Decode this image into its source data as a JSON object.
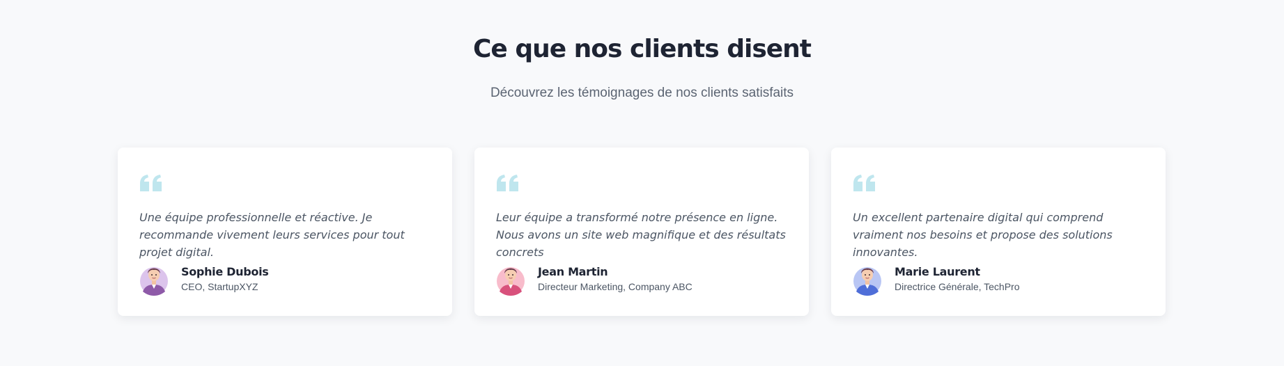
{
  "header": {
    "title": "Ce que nos clients disent",
    "subtitle": "Découvrez les témoignages de nos clients satisfaits"
  },
  "colors": {
    "quote_icon": "#bfe6ee",
    "background": "#f8f9fb",
    "card": "#ffffff"
  },
  "testimonials": [
    {
      "quote": "Une équipe professionnelle et réactive. Je recommande vivement leurs services pour tout projet digital.",
      "name": "Sophie Dubois",
      "role": "CEO, StartupXYZ",
      "avatar_icon": "avatar-purple-icon",
      "avatar_bg": "#dcc4ec",
      "shirt": "#8e5aa8"
    },
    {
      "quote": "Leur équipe a transformé notre présence en ligne. Nous avons un site web magnifique et des résultats concrets",
      "name": "Jean Martin",
      "role": "Directeur Marketing, Company ABC",
      "avatar_icon": "avatar-pink-icon",
      "avatar_bg": "#f8bccb",
      "shirt": "#d8517c"
    },
    {
      "quote": "Un excellent partenaire digital qui comprend vraiment nos besoins et propose des solutions innovantes.",
      "name": "Marie Laurent",
      "role": "Directrice Générale, TechPro",
      "avatar_icon": "avatar-blue-icon",
      "avatar_bg": "#b9c6f4",
      "shirt": "#4f6ed8"
    }
  ]
}
